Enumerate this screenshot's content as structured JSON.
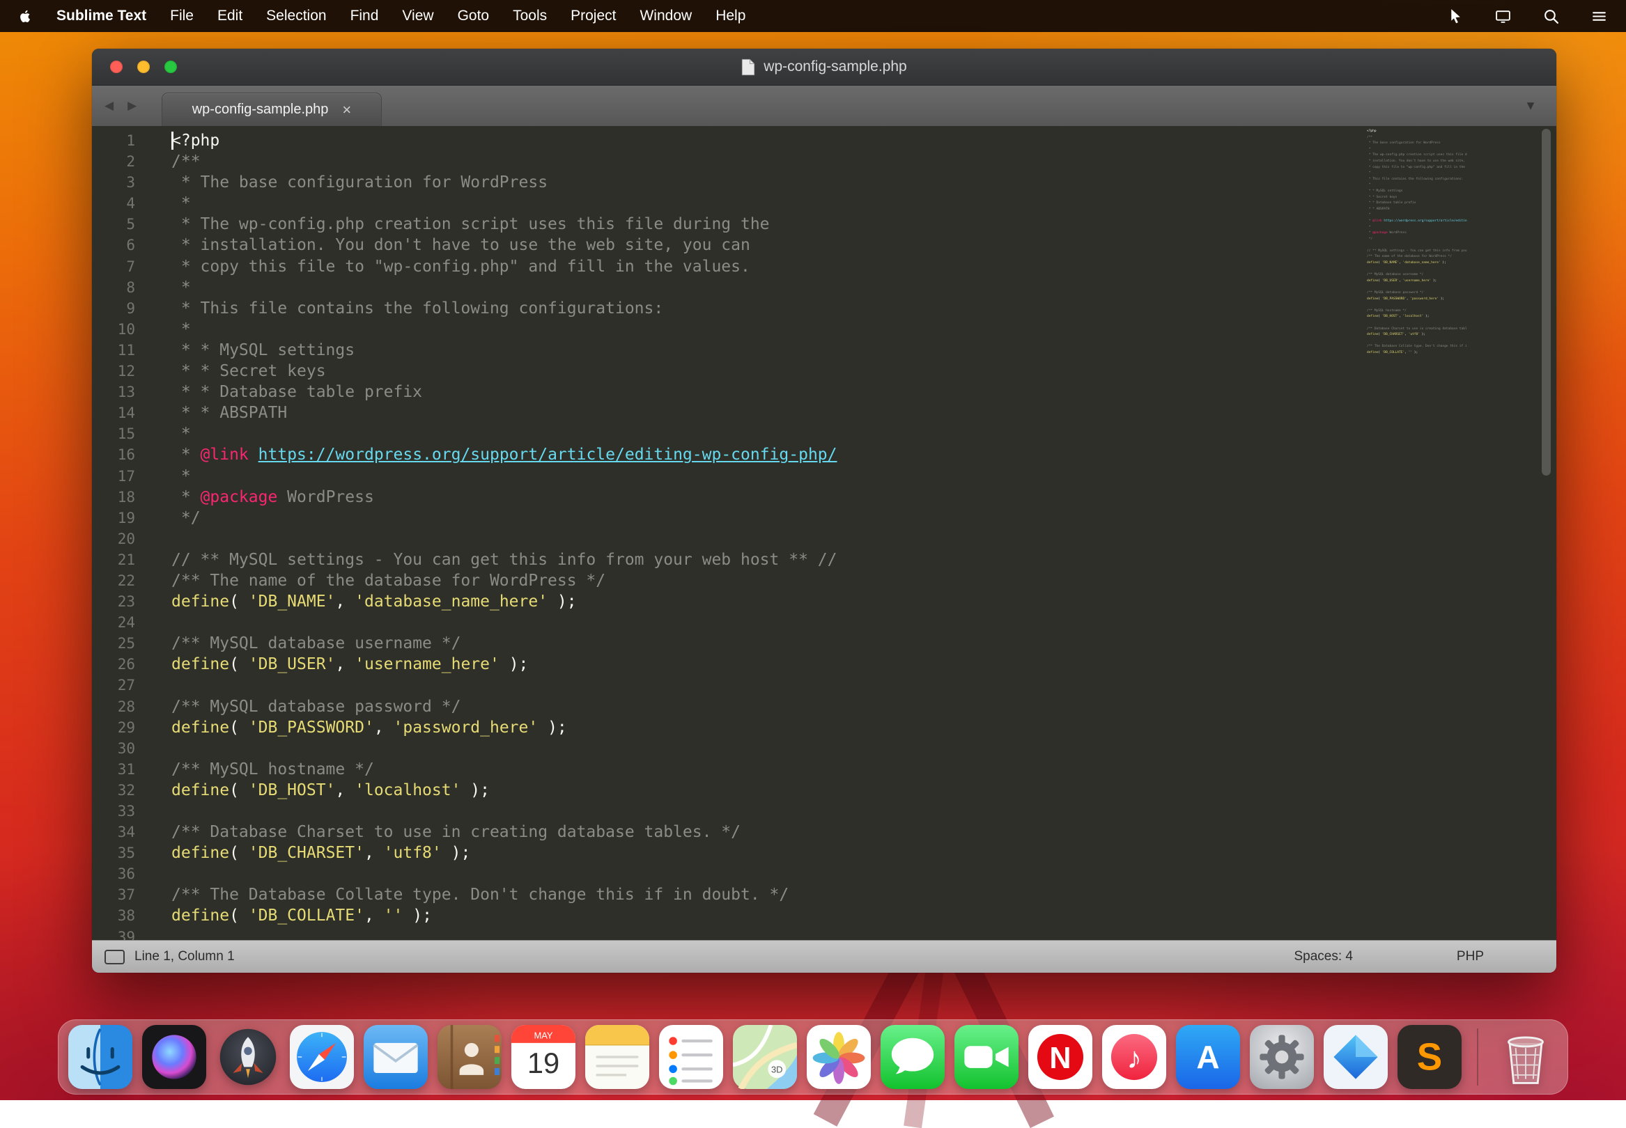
{
  "menubar": {
    "app_name": "Sublime Text",
    "items": [
      "File",
      "Edit",
      "Selection",
      "Find",
      "View",
      "Goto",
      "Tools",
      "Project",
      "Window",
      "Help"
    ],
    "status_icons": [
      "cursor-tool",
      "display",
      "spotlight-search",
      "notification-list"
    ]
  },
  "window": {
    "title": "wp-config-sample.php",
    "tab_label": "wp-config-sample.php",
    "tab_close": "×",
    "nav_back": "◀",
    "nav_forward": "▶",
    "dropdown": "▼",
    "statusbar": {
      "position": "Line 1, Column 1",
      "indent": "Spaces: 4",
      "syntax": "PHP"
    }
  },
  "editor": {
    "syntax_colors": {
      "base": "#f8f8f2",
      "comment": "#8b8c85",
      "keyword": "#f92672",
      "link": "#66d9ef",
      "string_and_function": "#e6db74",
      "background": "#2e2f29",
      "line_numbers": "#74756e"
    },
    "lines": [
      [
        [
          "base",
          "<?php"
        ]
      ],
      [
        [
          "comment",
          "/**"
        ]
      ],
      [
        [
          "comment",
          " * The base configuration for WordPress"
        ]
      ],
      [
        [
          "comment",
          " *"
        ]
      ],
      [
        [
          "comment",
          " * The wp-config.php creation script uses this file during the"
        ]
      ],
      [
        [
          "comment",
          " * installation. You don't have to use the web site, you can"
        ]
      ],
      [
        [
          "comment",
          " * copy this file to \"wp-config.php\" and fill in the values."
        ]
      ],
      [
        [
          "comment",
          " *"
        ]
      ],
      [
        [
          "comment",
          " * This file contains the following configurations:"
        ]
      ],
      [
        [
          "comment",
          " *"
        ]
      ],
      [
        [
          "comment",
          " * * MySQL settings"
        ]
      ],
      [
        [
          "comment",
          " * * Secret keys"
        ]
      ],
      [
        [
          "comment",
          " * * Database table prefix"
        ]
      ],
      [
        [
          "comment",
          " * * ABSPATH"
        ]
      ],
      [
        [
          "comment",
          " *"
        ]
      ],
      [
        [
          "comment",
          " * "
        ],
        [
          "keyword",
          "@link"
        ],
        [
          "comment",
          " "
        ],
        [
          "link",
          "https://wordpress.org/support/article/editing-wp-config-php/"
        ]
      ],
      [
        [
          "comment",
          " *"
        ]
      ],
      [
        [
          "comment",
          " * "
        ],
        [
          "keyword",
          "@package"
        ],
        [
          "comment",
          " WordPress"
        ]
      ],
      [
        [
          "comment",
          " */"
        ]
      ],
      [],
      [
        [
          "comment",
          "// ** MySQL settings - You can get this info from your web host ** //"
        ]
      ],
      [
        [
          "comment",
          "/** The name of the database for WordPress */"
        ]
      ],
      [
        [
          "yellow",
          "define"
        ],
        [
          "base",
          "( "
        ],
        [
          "yellow",
          "'DB_NAME'"
        ],
        [
          "base",
          ", "
        ],
        [
          "yellow",
          "'database_name_here'"
        ],
        [
          "base",
          " );"
        ]
      ],
      [],
      [
        [
          "comment",
          "/** MySQL database username */"
        ]
      ],
      [
        [
          "yellow",
          "define"
        ],
        [
          "base",
          "( "
        ],
        [
          "yellow",
          "'DB_USER'"
        ],
        [
          "base",
          ", "
        ],
        [
          "yellow",
          "'username_here'"
        ],
        [
          "base",
          " );"
        ]
      ],
      [],
      [
        [
          "comment",
          "/** MySQL database password */"
        ]
      ],
      [
        [
          "yellow",
          "define"
        ],
        [
          "base",
          "( "
        ],
        [
          "yellow",
          "'DB_PASSWORD'"
        ],
        [
          "base",
          ", "
        ],
        [
          "yellow",
          "'password_here'"
        ],
        [
          "base",
          " );"
        ]
      ],
      [],
      [
        [
          "comment",
          "/** MySQL hostname */"
        ]
      ],
      [
        [
          "yellow",
          "define"
        ],
        [
          "base",
          "( "
        ],
        [
          "yellow",
          "'DB_HOST'"
        ],
        [
          "base",
          ", "
        ],
        [
          "yellow",
          "'localhost'"
        ],
        [
          "base",
          " );"
        ]
      ],
      [],
      [
        [
          "comment",
          "/** Database Charset to use in creating database tables. */"
        ]
      ],
      [
        [
          "yellow",
          "define"
        ],
        [
          "base",
          "( "
        ],
        [
          "yellow",
          "'DB_CHARSET'"
        ],
        [
          "base",
          ", "
        ],
        [
          "yellow",
          "'utf8'"
        ],
        [
          "base",
          " );"
        ]
      ],
      [],
      [
        [
          "comment",
          "/** The Database Collate type. Don't change this if in doubt. */"
        ]
      ],
      [
        [
          "yellow",
          "define"
        ],
        [
          "base",
          "( "
        ],
        [
          "yellow",
          "'DB_COLLATE'"
        ],
        [
          "base",
          ", "
        ],
        [
          "yellow",
          "''"
        ],
        [
          "base",
          " );"
        ]
      ],
      []
    ]
  },
  "dock": {
    "items": [
      {
        "id": "finder",
        "label": "Finder"
      },
      {
        "id": "siri",
        "label": "Siri"
      },
      {
        "id": "launchpad",
        "label": "Launchpad"
      },
      {
        "id": "safari",
        "label": "Safari"
      },
      {
        "id": "mail",
        "label": "Mail"
      },
      {
        "id": "contacts",
        "label": "Contacts"
      },
      {
        "id": "calendar",
        "label": "Calendar"
      },
      {
        "id": "notes",
        "label": "Notes"
      },
      {
        "id": "reminders",
        "label": "Reminders"
      },
      {
        "id": "maps",
        "label": "Maps"
      },
      {
        "id": "photos",
        "label": "Photos"
      },
      {
        "id": "messages",
        "label": "Messages"
      },
      {
        "id": "facetime",
        "label": "FaceTime"
      },
      {
        "id": "netflix",
        "label": "Netflix"
      },
      {
        "id": "itunes",
        "label": "iTunes"
      },
      {
        "id": "app-store",
        "label": "App Store"
      },
      {
        "id": "system-preferences",
        "label": "System Preferences"
      },
      {
        "id": "blue-diamond-app",
        "label": "Blue diamond app"
      },
      {
        "id": "sublime-text",
        "label": "Sublime Text"
      },
      {
        "id": "trash",
        "label": "Trash"
      }
    ],
    "calendar": {
      "month": "MAY",
      "day": "19"
    },
    "maps_badge": "3D",
    "letters": {
      "netflix": "N",
      "appstore": "A",
      "sublime": "S",
      "music": "♪"
    }
  }
}
